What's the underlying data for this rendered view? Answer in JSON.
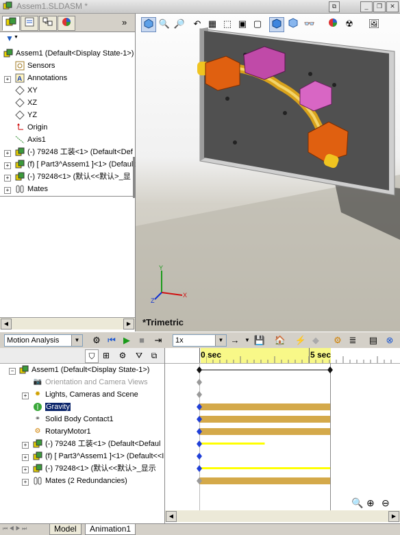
{
  "window": {
    "title": "Assem1.SLDASM *",
    "minimize_icon": "restore-icon",
    "buttons": [
      "minimize",
      "restore",
      "close"
    ]
  },
  "feature_tabs": [
    "feature-manager-icon",
    "property-manager-icon",
    "configuration-manager-icon",
    "display-manager-icon"
  ],
  "feature_tree": {
    "root": "Assem1  (Default<Display State-1>)",
    "items": [
      {
        "label": "Sensors",
        "icon": "sensor-icon"
      },
      {
        "label": "Annotations",
        "icon": "annotation-icon"
      },
      {
        "label": "XY",
        "icon": "plane-icon"
      },
      {
        "label": "XZ",
        "icon": "plane-icon"
      },
      {
        "label": "YZ",
        "icon": "plane-icon"
      },
      {
        "label": "Origin",
        "icon": "origin-icon"
      },
      {
        "label": "Axis1",
        "icon": "axis-icon"
      },
      {
        "label": "(-) 79248 工装<1> (Default<Def",
        "icon": "part-icon"
      },
      {
        "label": "(f) [ Part3^Assem1 ]<1> (Default<",
        "icon": "part-icon"
      },
      {
        "label": "(-) 79248<1> (默认<<默认>_显",
        "icon": "part-icon"
      },
      {
        "label": "Mates",
        "icon": "mates-icon"
      }
    ]
  },
  "viewport": {
    "view_label": "*Trimetric",
    "triad": {
      "x": "X",
      "y": "Y",
      "z": "Z"
    }
  },
  "motion_toolbar": {
    "study_type": "Motion Analysis",
    "playback_speed": "1x"
  },
  "motion_tree": {
    "root": "Assem1  (Default<Display State-1>)",
    "items": [
      {
        "label": "Orientation and Camera Views",
        "dim": true
      },
      {
        "label": "Lights, Cameras and Scene",
        "dim": false
      },
      {
        "label": "Gravity",
        "dim": false,
        "selected": true
      },
      {
        "label": "Solid Body Contact1",
        "dim": false
      },
      {
        "label": "RotaryMotor1",
        "dim": false
      },
      {
        "label": "(-) 79248 工装<1> (Default<Defaul",
        "dim": false
      },
      {
        "label": "(f) [ Part3^Assem1 ]<1> (Default<<I",
        "dim": false
      },
      {
        "label": "(-) 79248<1> (默认<<默认>_显示",
        "dim": false
      },
      {
        "label": "Mates (2 Redundancies)",
        "dim": false
      }
    ]
  },
  "timeline": {
    "tick_labels": [
      "0 sec",
      "5 sec"
    ],
    "duration_sec": 5,
    "rows": [
      {
        "type": "span",
        "key_color": "#111111",
        "bar_color": "#111111",
        "fraction": 1.0
      },
      {
        "type": "key",
        "key_color": "#999999"
      },
      {
        "type": "key",
        "key_color": "#999999"
      },
      {
        "type": "bar",
        "key_color": "#1f3fd8",
        "bar_color": "#d4a94a",
        "fraction": 1.0
      },
      {
        "type": "bar",
        "key_color": "#1f3fd8",
        "bar_color": "#d4a94a",
        "fraction": 1.0
      },
      {
        "type": "bar",
        "key_color": "#1f3fd8",
        "bar_color": "#d4a94a",
        "fraction": 1.0
      },
      {
        "type": "thin",
        "key_color": "#1f3fd8",
        "bar_color": "#ffff00",
        "fraction": 0.5
      },
      {
        "type": "key",
        "key_color": "#1f3fd8"
      },
      {
        "type": "thin",
        "key_color": "#1f3fd8",
        "bar_color": "#ffff00",
        "fraction": 1.0
      },
      {
        "type": "bar",
        "key_color": "#999999",
        "bar_color": "#d4a94a",
        "fraction": 1.0
      }
    ]
  },
  "bottom_tabs": {
    "model": "Model",
    "animation": "Animation1"
  },
  "colors": {
    "timebar": "#f8f888",
    "selection": "#0a246a",
    "keypoint": "#1f3fd8"
  }
}
